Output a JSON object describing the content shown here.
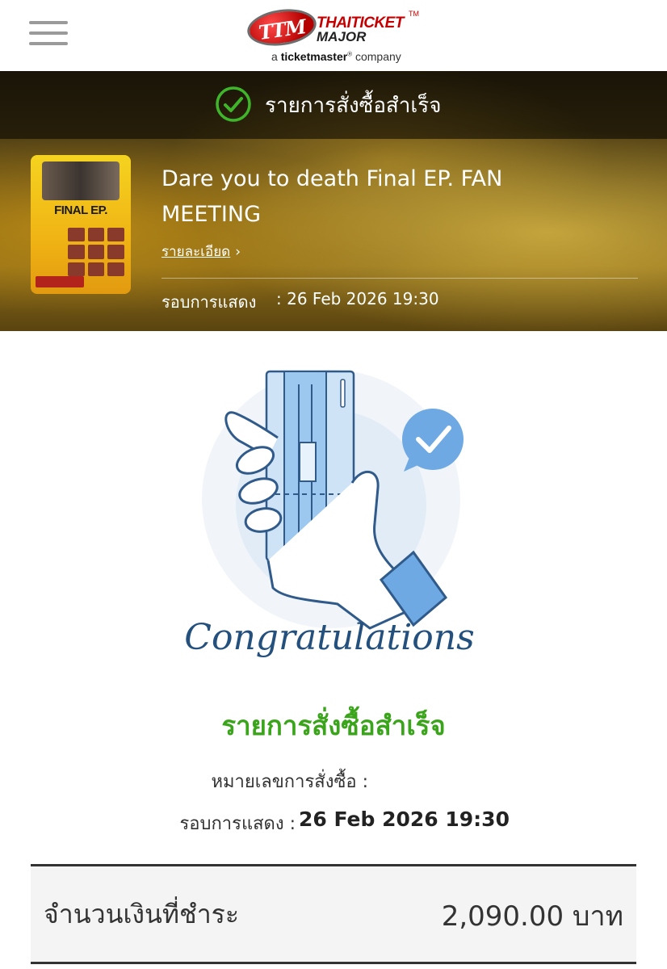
{
  "header": {
    "menu_icon": "hamburger-menu-icon",
    "logo_badge": "TTM",
    "logo_line1": "THAITICKET",
    "logo_line2": "MAJOR",
    "logo_tm": "TM",
    "logo_sub_prefix": "a ",
    "logo_sub_brand": "ticketmaster",
    "logo_sub_reg": "®",
    "logo_sub_suffix": " company"
  },
  "banner": {
    "status_icon": "check-circle-icon",
    "status_title": "รายการสั่งซื้อสำเร็จ",
    "event_title": "Dare you to death Final EP. FAN MEETING",
    "poster_title": "FINAL EP.",
    "detail_link": "รายละเอียด",
    "detail_chevron": "›",
    "show_label": "รอบการแสดง",
    "show_value": ": 26 Feb 2026 19:30"
  },
  "illustration": {
    "icon": "hand-holding-ticket-icon",
    "caption": "Congratulations",
    "check_icon": "check-bubble-icon"
  },
  "success": {
    "title": "รายการสั่งซื้อสำเร็จ",
    "order_label": "หมายเลขการสั่งซื้อ :",
    "show_label": "รอบการแสดง :",
    "show_value": "26 Feb 2026 19:30"
  },
  "payment": {
    "label": "จำนวนเงินที่ชำระ",
    "value": "2,090.00 บาท"
  },
  "colors": {
    "success_green": "#3aa41b",
    "brand_red": "#c60000",
    "illustration_blue": "#7db3e8"
  }
}
